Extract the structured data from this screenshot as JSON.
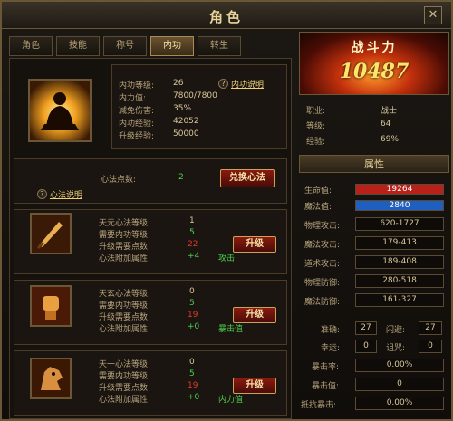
{
  "window": {
    "title": "角色"
  },
  "tabs": [
    {
      "label": "角色"
    },
    {
      "label": "技能"
    },
    {
      "label": "称号"
    },
    {
      "label": "内功"
    },
    {
      "label": "转生"
    }
  ],
  "inner": {
    "level_label": "内功等级:",
    "level_value": "26",
    "power_label": "内力值:",
    "power_value": "7800/7800",
    "reduce_label": "减免伤害:",
    "reduce_value": "35%",
    "exp_label": "内功经验:",
    "exp_value": "42052",
    "upgrade_exp_label": "升级经验:",
    "upgrade_exp_value": "50000",
    "help_link": "内功说明"
  },
  "heart": {
    "points_label": "心法点数:",
    "points_value": "2",
    "exchange_button": "兑换心法",
    "help_link": "心法说明"
  },
  "skills": [
    {
      "name_label": "天元心法等级:",
      "level": "1",
      "need_label": "需要内功等级:",
      "need_level": "5",
      "cost_label": "升级需要点数:",
      "cost": "22",
      "bonus_label": "心法附加属性:",
      "bonus": "+4",
      "attr": "攻击",
      "button": "升级",
      "icon": "dagger-icon"
    },
    {
      "name_label": "天玄心法等级:",
      "level": "0",
      "need_label": "需要内功等级:",
      "need_level": "5",
      "cost_label": "升级需要点数:",
      "cost": "19",
      "bonus_label": "心法附加属性:",
      "bonus": "+0",
      "attr": "暴击值",
      "button": "升级",
      "icon": "fist-icon"
    },
    {
      "name_label": "天一心法等级:",
      "level": "0",
      "need_label": "需要内功等级:",
      "need_level": "5",
      "cost_label": "升级需要点数:",
      "cost": "19",
      "bonus_label": "心法附加属性:",
      "bonus": "+0",
      "attr": "内力值",
      "button": "升级",
      "icon": "beast-icon"
    }
  ],
  "power": {
    "title": "战斗力",
    "value": "10487"
  },
  "profile": {
    "job_label": "职业:",
    "job": "战士",
    "level_label": "等级:",
    "level": "64",
    "exp_label": "经验:",
    "exp": "69%"
  },
  "attrs": {
    "header": "属性",
    "hp_label": "生命值:",
    "hp": "19264",
    "mp_label": "魔法值:",
    "mp": "2840",
    "rows": [
      {
        "label": "物理攻击:",
        "value": "620-1727"
      },
      {
        "label": "魔法攻击:",
        "value": "179-413"
      },
      {
        "label": "道术攻击:",
        "value": "189-408"
      },
      {
        "label": "物理防御:",
        "value": "280-518"
      },
      {
        "label": "魔法防御:",
        "value": "161-327"
      }
    ],
    "accuracy_label": "准确:",
    "accuracy": "27",
    "dodge_label": "闪避:",
    "dodge": "27",
    "luck_label": "幸运:",
    "luck": "0",
    "curse_label": "诅咒:",
    "curse": "0",
    "crit_rate_label": "暴击率:",
    "crit_rate": "0.00%",
    "crit_value_label": "暴击值:",
    "crit_value": "0",
    "anti_crit_label": "抵抗暴击:",
    "anti_crit": "0.00%"
  },
  "colors": {
    "hp_bar": "#b8201a",
    "mp_bar": "#1f5fbf",
    "accent": "#f0d27a"
  }
}
